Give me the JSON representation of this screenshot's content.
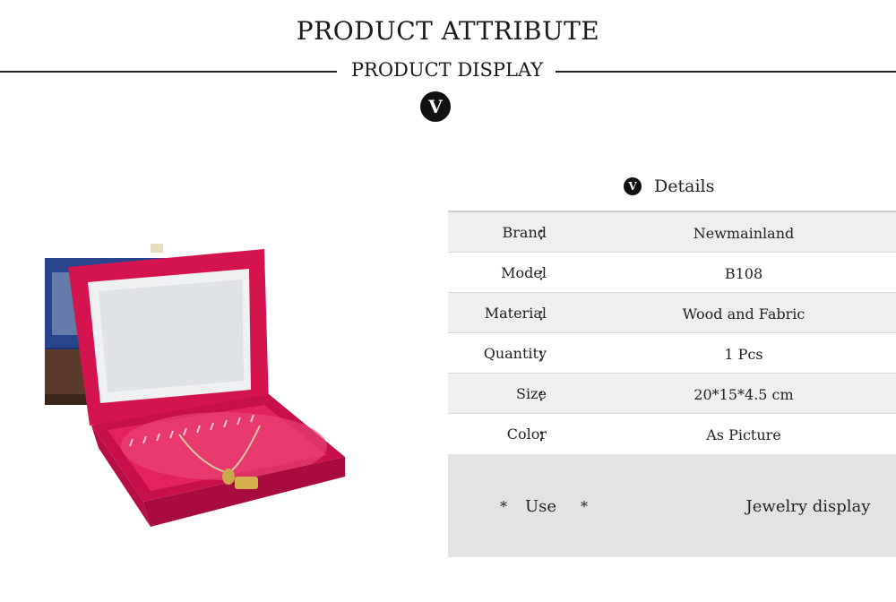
{
  "header": {
    "title": "PRODUCT ATTRIBUTE",
    "subtitle": "PRODUCT DISPLAY",
    "badge": "V"
  },
  "details": {
    "badge": "V",
    "label": "Details",
    "rows": [
      {
        "label": "Brand",
        "colon": "：",
        "value": "Newmainland"
      },
      {
        "label": "Model",
        "colon": "：",
        "value": "B108"
      },
      {
        "label": "Material",
        "colon": "：",
        "value": "Wood and Fabric"
      },
      {
        "label": "Quantity",
        "colon": "：",
        "value": "1 Pcs"
      },
      {
        "label": "Size",
        "colon": "：",
        "value": "20*15*4.5 cm"
      },
      {
        "label": "Color",
        "colon": "：",
        "value": "As Picture"
      }
    ],
    "use": {
      "star": "*",
      "label": "Use",
      "value": "Jewelry display"
    }
  },
  "colors": {
    "box": "#d4144f",
    "box_blue": "#27448c",
    "box_brown": "#5a3a2a",
    "shade_row": "#efefef",
    "use_bg": "#e3e3e3"
  }
}
